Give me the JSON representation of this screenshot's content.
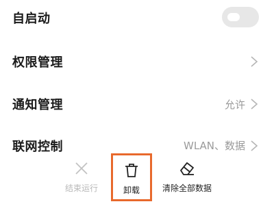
{
  "settings": {
    "autostart": {
      "label": "自启动",
      "enabled": false
    },
    "permissions": {
      "label": "权限管理"
    },
    "notifications": {
      "label": "通知管理",
      "value": "允许"
    },
    "network": {
      "label": "联网控制",
      "value": "WLAN、数据"
    }
  },
  "actions": {
    "stop": {
      "label": "结束运行",
      "icon": "close-icon",
      "enabled": false
    },
    "uninstall": {
      "label": "卸载",
      "icon": "trash-icon",
      "highlight_color": "#e8692c"
    },
    "clear": {
      "label": "清除全部数据",
      "icon": "eraser-icon"
    }
  }
}
